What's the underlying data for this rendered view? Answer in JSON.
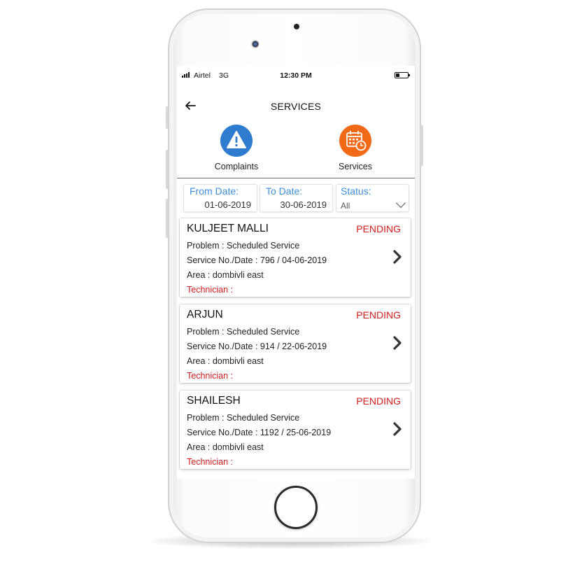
{
  "status_bar": {
    "carrier": "Airtel",
    "network": "3G",
    "time": "12:30 PM"
  },
  "header": {
    "title": "SERVICES"
  },
  "tabs": [
    {
      "label": "Complaints",
      "icon": "warning-icon",
      "color": "#2f7bd0"
    },
    {
      "label": "Services",
      "icon": "calendar-clock-icon",
      "color": "#f26a17"
    }
  ],
  "filters": {
    "from_date": {
      "label": "From Date:",
      "value": "01-06-2019"
    },
    "to_date": {
      "label": "To Date:",
      "value": "30-06-2019"
    },
    "status": {
      "label": "Status:",
      "value": "All"
    }
  },
  "services": [
    {
      "name": "KULJEET MALLI",
      "status": "PENDING",
      "problem": "Problem : Scheduled Service",
      "service": "Service No./Date : 796 / 04-06-2019",
      "area": "Area : dombivli east",
      "technician": "Technician :"
    },
    {
      "name": "ARJUN",
      "status": "PENDING",
      "problem": "Problem : Scheduled Service",
      "service": "Service No./Date : 914 / 22-06-2019",
      "area": "Area : dombivli east",
      "technician": "Technician :"
    },
    {
      "name": "SHAILESH",
      "status": "PENDING",
      "problem": "Problem : Scheduled Service",
      "service": "Service No./Date : 1192 / 25-06-2019",
      "area": "Area : dombivli east",
      "technician": "Technician :"
    }
  ],
  "colors": {
    "accent_blue": "#3f8ed8",
    "pending_red": "#d21e1e",
    "complaints_blue": "#2f7bd0",
    "services_orange": "#f26a17"
  }
}
